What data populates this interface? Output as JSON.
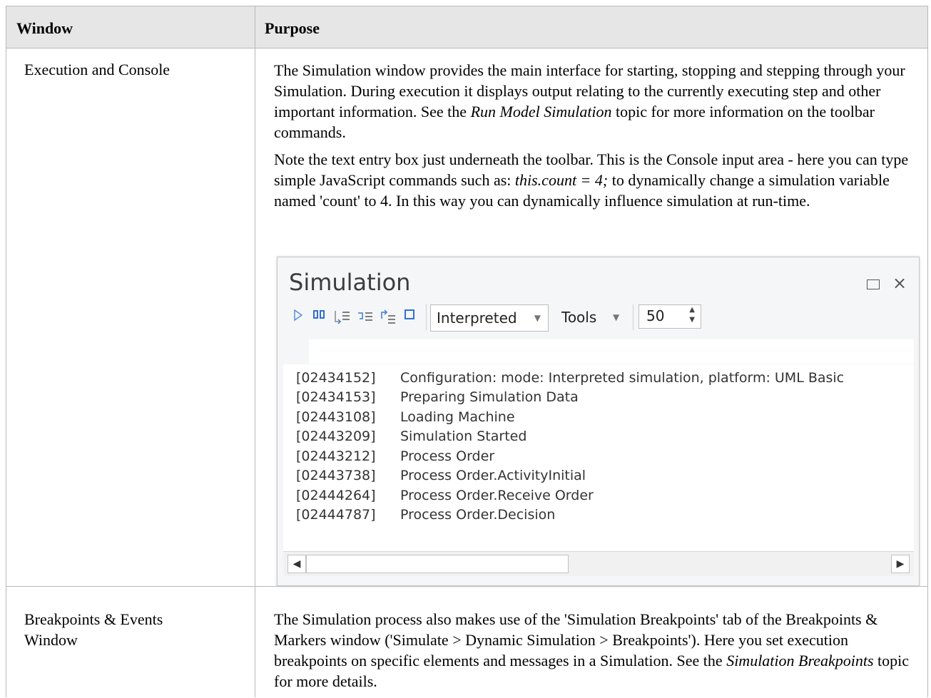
{
  "table": {
    "headers": [
      "Window",
      "Purpose"
    ],
    "rows": [
      {
        "window": "Execution and Console",
        "purpose_p1_a": "The Simulation window provides the main interface for starting, stopping and stepping through your Simulation. During execution it displays output relating to the currently executing step and other important information. See the ",
        "purpose_p1_italic": "Run Model Simulation",
        "purpose_p1_b": " topic for more information on the toolbar commands.",
        "purpose_p2_a": "Note the text entry box just underneath the toolbar. This is the Console input area - here you can type simple JavaScript commands such as: ",
        "purpose_p2_italic": "this.count = 4;",
        "purpose_p2_b": " to dynamically change a simulation variable named 'count' to 4. In this way you can dynamically influence simulation at run-time."
      },
      {
        "window_line1": "Breakpoints & Events",
        "window_line2": "Window",
        "purpose_a": "The Simulation process also makes use of the 'Simulation Breakpoints' tab of the Breakpoints & Markers window ('Simulate > Dynamic Simulation > Breakpoints'). Here you set execution breakpoints on specific elements and messages in a Simulation. See the ",
        "purpose_italic": "Simulation Breakpoints",
        "purpose_b": " topic for more details."
      }
    ]
  },
  "simulation": {
    "title": "Simulation",
    "maximize_icon": "maximize-icon",
    "close_glyph": "×",
    "toolbar": {
      "run_icon": "play-icon",
      "pause_icon": "pause-icon",
      "step_in_icon": "step-in-icon",
      "step_over_icon": "step-over-icon",
      "step_out_icon": "step-out-icon",
      "stop_icon": "stop-icon",
      "mode_value": "Interpreted",
      "tools_label": "Tools",
      "speed_value": "50"
    },
    "console_input_value": "",
    "log": [
      {
        "ts": "[02434152]",
        "msg": "Configuration: mode: Interpreted simulation, platform: UML Basic"
      },
      {
        "ts": "[02434153]",
        "msg": "Preparing Simulation Data"
      },
      {
        "ts": "[02443108]",
        "msg": "Loading Machine"
      },
      {
        "ts": "[02443209]",
        "msg": "Simulation Started"
      },
      {
        "ts": "[02443212]",
        "msg": "Process Order"
      },
      {
        "ts": "[02443738]",
        "msg": "Process Order.ActivityInitial"
      },
      {
        "ts": "[02444264]",
        "msg": "Process Order.Receive Order"
      },
      {
        "ts": "[02444787]",
        "msg": "Process Order.Decision"
      }
    ]
  }
}
